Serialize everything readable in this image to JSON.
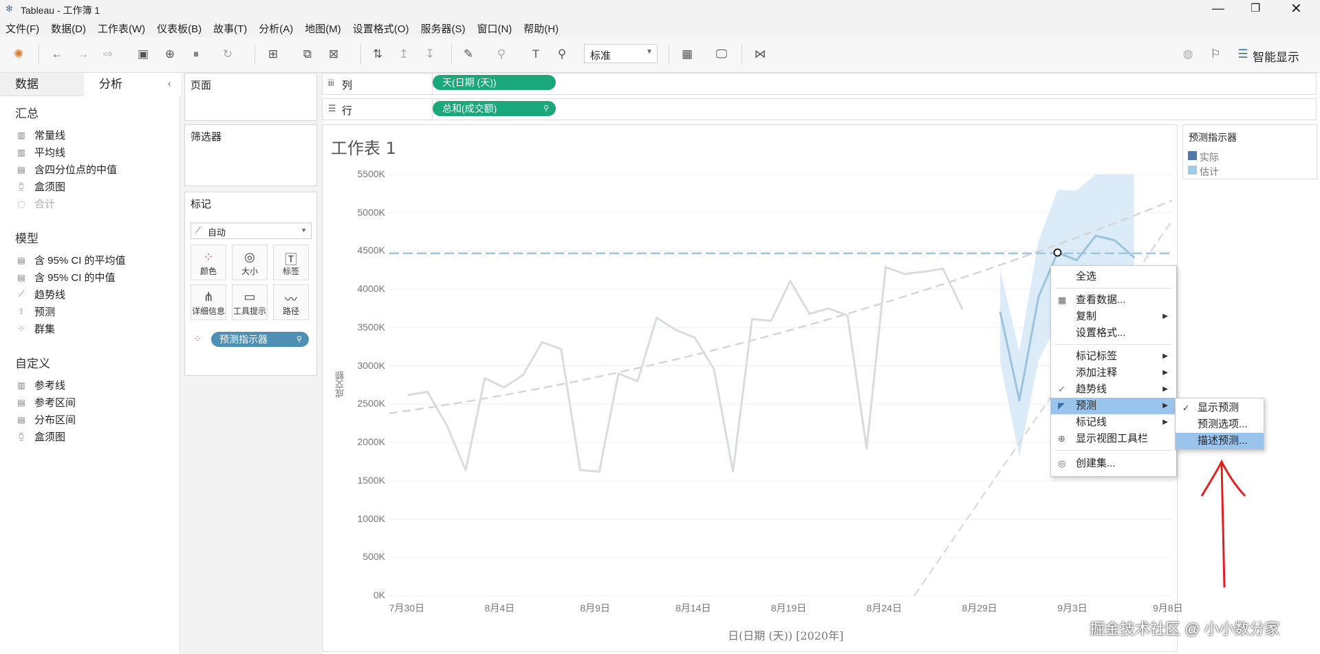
{
  "window": {
    "title": "Tableau - 工作簿 1",
    "controls": [
      "minimize-icon",
      "restore-icon",
      "close-icon"
    ]
  },
  "menu": [
    "文件(F)",
    "数据(D)",
    "工作表(W)",
    "仪表板(B)",
    "故事(T)",
    "分析(A)",
    "地图(M)",
    "设置格式(O)",
    "服务器(S)",
    "窗口(N)",
    "帮助(H)"
  ],
  "toolbar": {
    "fit_select": "标准",
    "show_me": "智能显示"
  },
  "leftpane": {
    "tabs": [
      "数据",
      "分析"
    ],
    "active_tab": "分析",
    "sections": [
      {
        "title": "汇总",
        "items": [
          {
            "label": "常量线",
            "icon": "constant-line-icon",
            "disabled": false
          },
          {
            "label": "平均线",
            "icon": "average-line-icon",
            "disabled": false
          },
          {
            "label": "含四分位点的中值",
            "icon": "median-quartiles-icon",
            "disabled": false
          },
          {
            "label": "盒须图",
            "icon": "box-plot-icon",
            "disabled": false
          },
          {
            "label": "合计",
            "icon": "totals-icon",
            "disabled": true
          }
        ]
      },
      {
        "title": "模型",
        "items": [
          {
            "label": "含 95% CI 的平均值",
            "icon": "average-ci-icon",
            "disabled": false
          },
          {
            "label": "含 95% CI 的中值",
            "icon": "median-ci-icon",
            "disabled": false
          },
          {
            "label": "趋势线",
            "icon": "trend-line-icon",
            "disabled": false
          },
          {
            "label": "预测",
            "icon": "forecast-icon",
            "disabled": false
          },
          {
            "label": "群集",
            "icon": "cluster-icon",
            "disabled": false
          }
        ]
      },
      {
        "title": "自定义",
        "items": [
          {
            "label": "参考线",
            "icon": "reference-line-icon",
            "disabled": false
          },
          {
            "label": "参考区间",
            "icon": "reference-band-icon",
            "disabled": false
          },
          {
            "label": "分布区间",
            "icon": "distribution-band-icon",
            "disabled": false
          },
          {
            "label": "盒须图",
            "icon": "box-plot-icon",
            "disabled": false
          }
        ]
      }
    ]
  },
  "cards": {
    "pages": "页面",
    "filters": "筛选器",
    "marks": "标记",
    "mark_type": "自动",
    "mark_buttons": [
      "颜色",
      "大小",
      "标签",
      "详细信息",
      "工具提示",
      "路径"
    ],
    "marks_pill": "预测指示器"
  },
  "shelves": {
    "columns_label": "列",
    "columns_pill": "天(日期 (天))",
    "rows_label": "行",
    "rows_pill": "总和(成交额)"
  },
  "legend": {
    "title": "预测指示器",
    "items": [
      {
        "label": "实际",
        "color": "#4e79a7"
      },
      {
        "label": "估计",
        "color": "#a0cbe8"
      }
    ]
  },
  "chart_data": {
    "type": "line",
    "title": "工作表 1",
    "xlabel": "日(日期 (天)) [2020年]",
    "ylabel": "成交额",
    "ylim": [
      0,
      5500
    ],
    "yticks": [
      "5500K",
      "5000K",
      "4500K",
      "4000K",
      "3500K",
      "3000K",
      "2500K",
      "2000K",
      "1500K",
      "1000K",
      "500K",
      "0K"
    ],
    "xticks": [
      "7月30日",
      "8月4日",
      "8月9日",
      "8月14日",
      "8月19日",
      "8月24日",
      "8月29日",
      "9月3日",
      "9月8日"
    ],
    "series": [
      {
        "name": "实际",
        "x": [
          1,
          2,
          3,
          4,
          5,
          6,
          7,
          8,
          9,
          10,
          11,
          12,
          13,
          14,
          15,
          16,
          17,
          18,
          19,
          20,
          21,
          22,
          23,
          24,
          25,
          26,
          27,
          28,
          29,
          30,
          31,
          32
        ],
        "values": [
          2620,
          2660,
          2230,
          1640,
          2840,
          2720,
          2880,
          3310,
          3220,
          1640,
          1620,
          2900,
          2800,
          3630,
          3470,
          3370,
          2960,
          1620,
          3610,
          3590,
          4110,
          3680,
          3750,
          3660,
          1920,
          4290,
          4200,
          4230,
          4270,
          3750,
          null,
          null
        ]
      },
      {
        "name": "估计",
        "x": [
          32,
          33,
          34,
          35,
          36,
          37,
          38,
          39,
          40
        ],
        "values": [
          3700,
          2550,
          3900,
          4480,
          4380,
          4700,
          4640,
          4420,
          null
        ]
      }
    ],
    "reference_line_value": 4470,
    "grid": true
  },
  "context_menu": {
    "items": [
      "全选",
      "查看数据...",
      "复制",
      "设置格式...",
      "标记标签",
      "添加注释",
      "趋势线",
      "预测",
      "标记线",
      "显示视图工具栏",
      "创建集..."
    ],
    "highlighted": "预测"
  },
  "submenu": {
    "items": [
      "显示预测",
      "预测选项...",
      "描述预测..."
    ],
    "checked": "显示预测",
    "highlighted": "描述预测..."
  },
  "watermark": "掘金技术社区 @ 小小数分家"
}
